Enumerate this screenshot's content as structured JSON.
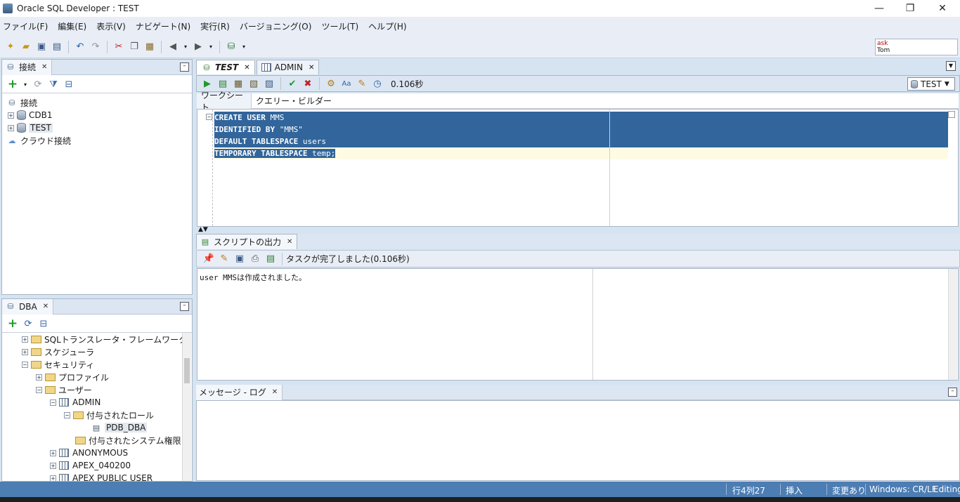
{
  "window": {
    "title": "Oracle SQL Developer : TEST",
    "min": "—",
    "restore": "❐",
    "close": "✕"
  },
  "menu": [
    "ファイル(F)",
    "編集(E)",
    "表示(V)",
    "ナビゲート(N)",
    "実行(R)",
    "バージョニング(O)",
    "ツール(T)",
    "ヘルプ(H)"
  ],
  "asktom": {
    "line1": "ask",
    "line2": "Tom"
  },
  "connections_panel": {
    "tab": "接続",
    "root": "接続",
    "items": [
      "CDB1",
      "TEST"
    ],
    "cloud": "クラウド接続"
  },
  "dba_panel": {
    "tab": "DBA",
    "tree": [
      "SQLトランスレータ・フレームワーク",
      "スケジューラ",
      "セキュリティ",
      "プロファイル",
      "ユーザー",
      "ADMIN",
      "付与されたロール",
      "PDB_DBA",
      "付与されたシステム権限",
      "ANONYMOUS",
      "APEX_040200",
      "APEX PUBLIC USER"
    ]
  },
  "editor": {
    "tabs": [
      "TEST",
      "ADMIN"
    ],
    "elapsed": "0.106秒",
    "connection": "TEST",
    "subtabs": [
      "ワークシート",
      "クエリー・ビルダー"
    ],
    "code": [
      {
        "kw": "CREATE USER",
        "rest": " MMS"
      },
      {
        "kw": "IDENTIFIED BY",
        "rest": " \"MMS\""
      },
      {
        "kw": "DEFAULT TABLESPACE",
        "rest": " users"
      },
      {
        "kw": "TEMPORARY TABLESPACE",
        "rest": " temp;"
      }
    ]
  },
  "script_output": {
    "tab": "スクリプトの出力",
    "status": "タスクが完了しました(0.106秒)",
    "text": "user MMSは作成されました。"
  },
  "message_log": {
    "tab": "メッセージ - ログ"
  },
  "statusbar": {
    "position": "行4列27",
    "mode": "挿入",
    "modified": "変更あり",
    "lineend": "Windows: CR/LF",
    "state": "Editing"
  },
  "colors": {
    "selection": "#31659b",
    "status_bar": "#4c7db3",
    "current_line": "#fdfbe3"
  }
}
